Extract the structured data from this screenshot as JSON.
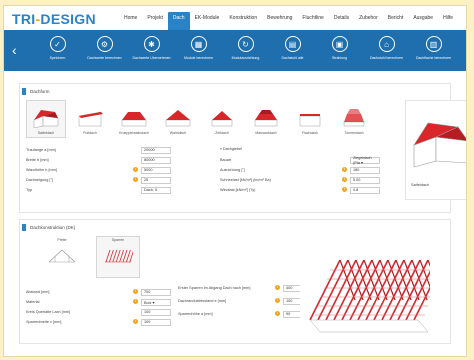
{
  "app": {
    "logo_main": "TRI",
    "logo_dash": "-",
    "logo_sub": "DESIGN"
  },
  "menu": [
    "Home",
    "Projekt",
    "Dach",
    "EK-Module",
    "Konstruktion",
    "Bewehrung",
    "Fluchtline",
    "Details",
    "Zubehor",
    "Bericht",
    "Ausgabe",
    "Hilfe"
  ],
  "menu_active_index": 2,
  "toolbar": {
    "back_icon": "chevron-left-icon",
    "items": [
      {
        "label": "Speichern",
        "icon": "check-icon"
      },
      {
        "label": "Dachwerte berechnen",
        "icon": "settings-icon"
      },
      {
        "label": "Dachwerte Ubernehmen",
        "icon": "gear-icon"
      },
      {
        "label": "Module berechnen",
        "icon": "module-icon"
      },
      {
        "label": "Modulausrichtung",
        "icon": "rotate-icon"
      },
      {
        "label": "Dachstuhl alle",
        "icon": "grid-icon"
      },
      {
        "label": "Strahlung",
        "icon": "calculator-icon"
      },
      {
        "label": "Dachstuhl berechnen",
        "icon": "roof-calc-icon"
      },
      {
        "label": "Dachflache berechnen",
        "icon": "save-icon"
      }
    ]
  },
  "roof_panel": {
    "title": "Dachform",
    "types": [
      "Satteldach",
      "Pultdach",
      "Krueppelwalmdach",
      "Walmdach",
      "Zeltdach",
      "Mansarddach",
      "Flachdach",
      "Tonnendach"
    ],
    "selected_index": 0,
    "left_fields": [
      {
        "label": "Traufange a [mm]",
        "value": "20000",
        "info": false
      },
      {
        "label": "Breite b [mm]",
        "value": "80000",
        "info": false
      },
      {
        "label": "Wandhöhe h [mm]",
        "value": "5000",
        "info": true
      },
      {
        "label": "Dachneigung [°]",
        "value": "25",
        "info": true
      },
      {
        "label": "Typ",
        "value": "Dach, 5",
        "info": false
      }
    ],
    "right_header": "Dachgiebel",
    "right_fields": [
      {
        "label": "Bauart",
        "value": "Ziegeldach (Pfa ▾",
        "info": false
      },
      {
        "label": "Ausrichtung [°]",
        "value": "180",
        "info": true
      },
      {
        "label": "Schneelast [kN/m²] (kn/m² Ba)",
        "value": "5.00",
        "info": true
      },
      {
        "label": "Windlast [kN/m²] (Ty)",
        "value": "0.8",
        "info": true
      }
    ],
    "house_caption": "Satteldach"
  },
  "struct_panel": {
    "title": "Dachkonstruktion (DK)",
    "types": [
      "Pfette",
      "Sparren"
    ],
    "selected_index": 1,
    "left_fields": [
      {
        "label": "Abstand [mm]",
        "value": "700",
        "info": true
      },
      {
        "label": "Material",
        "value": "Bolz ▾",
        "info": true
      },
      {
        "label": "Kreis Querlatte Laxn [mm]",
        "value": "100",
        "info": false
      },
      {
        "label": "Sparrenbreite c [mm]",
        "value": "100",
        "info": true
      }
    ],
    "right_fields": [
      {
        "label": "Erster Sparren im Abgang Dach nach [mm]",
        "value": "400",
        "info": true
      },
      {
        "label": "Dachrandueberstand e [mm]",
        "value": "100",
        "info": true
      },
      {
        "label": "Sparrenhöhe a [mm]",
        "value": "90",
        "info": true
      }
    ]
  }
}
